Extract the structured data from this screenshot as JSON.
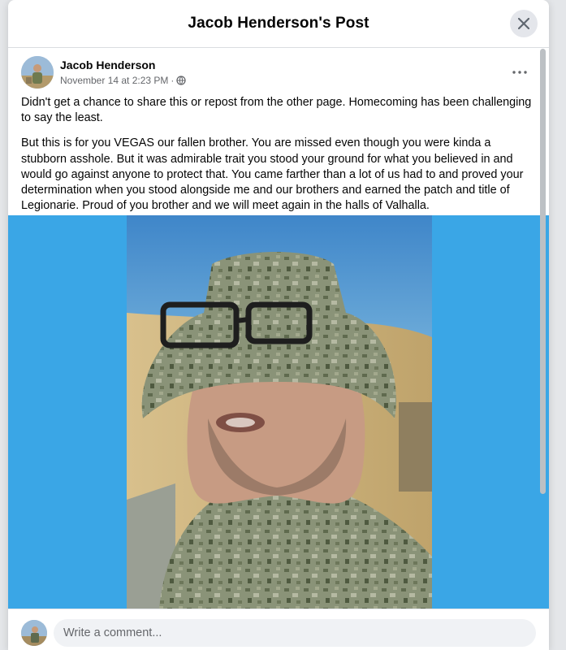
{
  "modal": {
    "title": "Jacob Henderson's Post"
  },
  "post": {
    "author": "Jacob Henderson",
    "timestamp": "November 14 at 2:23 PM",
    "separator": "·",
    "audience_icon": "globe-icon",
    "paragraphs": [
      "Didn't get a chance to share this or repost from the other page. Homecoming has been challenging to say the least.",
      "But this is for you VEGAS our fallen brother. You are missed even though you were kinda a stubborn asshole. But it was admirable trait you stood your ground for what you believed in and would go against anyone to protect that. You came farther than a lot of us had to and proved your determination when you stood alongside me and our brothers and earned the patch and title of Legionarie. Proud of you brother and we will meet again in the halls of Valhalla."
    ]
  },
  "comment_box": {
    "placeholder": "Write a comment..."
  },
  "colors": {
    "photo_background": "#3aa6e6",
    "text_primary": "#050505",
    "text_secondary": "#65676b"
  }
}
